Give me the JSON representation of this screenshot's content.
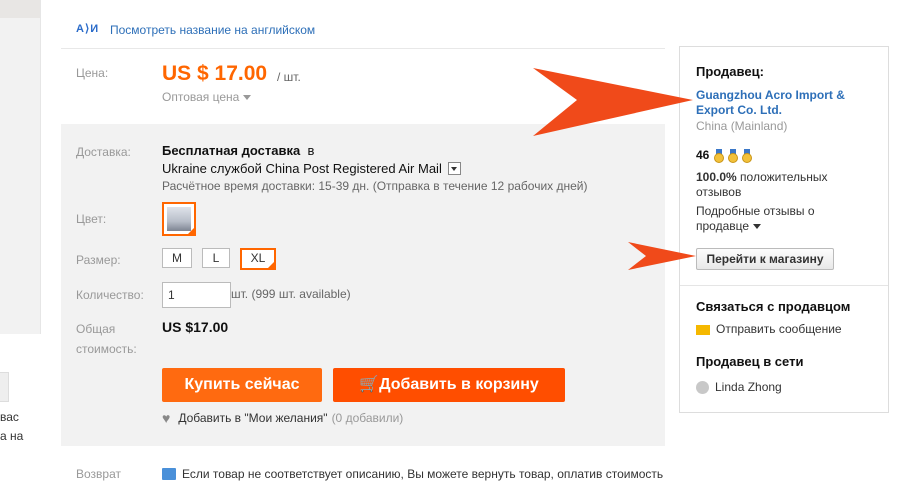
{
  "left_panel": {
    "text_line1": "вас",
    "text_line2": "а на"
  },
  "translate": {
    "label": "Посмотреть название на английском",
    "icon": "translate-icon"
  },
  "price": {
    "label": "Цена:",
    "value": "US $ 17.00",
    "unit": "/ шт.",
    "wholesale": "Оптовая цена"
  },
  "shipping": {
    "label": "Доставка:",
    "title_bold": "Бесплатная доставка",
    "title_in": "в",
    "destination": "Ukraine службой China Post Registered Air Mail",
    "time": "Расчётное время доставки: 15-39 дн. (Отправка в течение 12 рабочих дней)"
  },
  "color": {
    "label": "Цвет:"
  },
  "size": {
    "label": "Размер:",
    "options": [
      "M",
      "L",
      "XL"
    ],
    "selected": "XL"
  },
  "quantity": {
    "label": "Количество:",
    "value": "1",
    "note": "шт. (999 шт. available)"
  },
  "total": {
    "label_line1": "Общая",
    "label_line2": "стоимость:",
    "value": "US $17.00"
  },
  "actions": {
    "buy": "Купить сейчас",
    "cart": "Добавить в корзину",
    "wishlist": "Добавить в \"Мои желания\"",
    "wishlist_count": "(0 добавили)"
  },
  "returns": {
    "label": "Возврат",
    "text": "Если товар не соответствует описанию, Вы можете вернуть товар, оплатив стоимость"
  },
  "seller": {
    "title": "Продавец:",
    "name_line1": "Guangzhou Acro Import &",
    "name_line2": "Export Co. Ltd.",
    "country": "China (Mainland)",
    "score": "46",
    "positive_pct": "100.0%",
    "positive_text1": "положительных",
    "positive_text2": "отзывов",
    "detailed_line1": "Подробные отзывы о",
    "detailed_line2": "продавце",
    "store_button": "Перейти к магазину",
    "contact_title": "Связаться с продавцом",
    "send_message": "Отправить сообщение",
    "online_title": "Продавец в сети",
    "online_user": "Linda Zhong"
  },
  "colors": {
    "accent": "#ff6600",
    "buy": "#ff6a10",
    "cart": "#ff4e00",
    "link": "#2d6fb8",
    "arrow": "#f04a1a"
  }
}
